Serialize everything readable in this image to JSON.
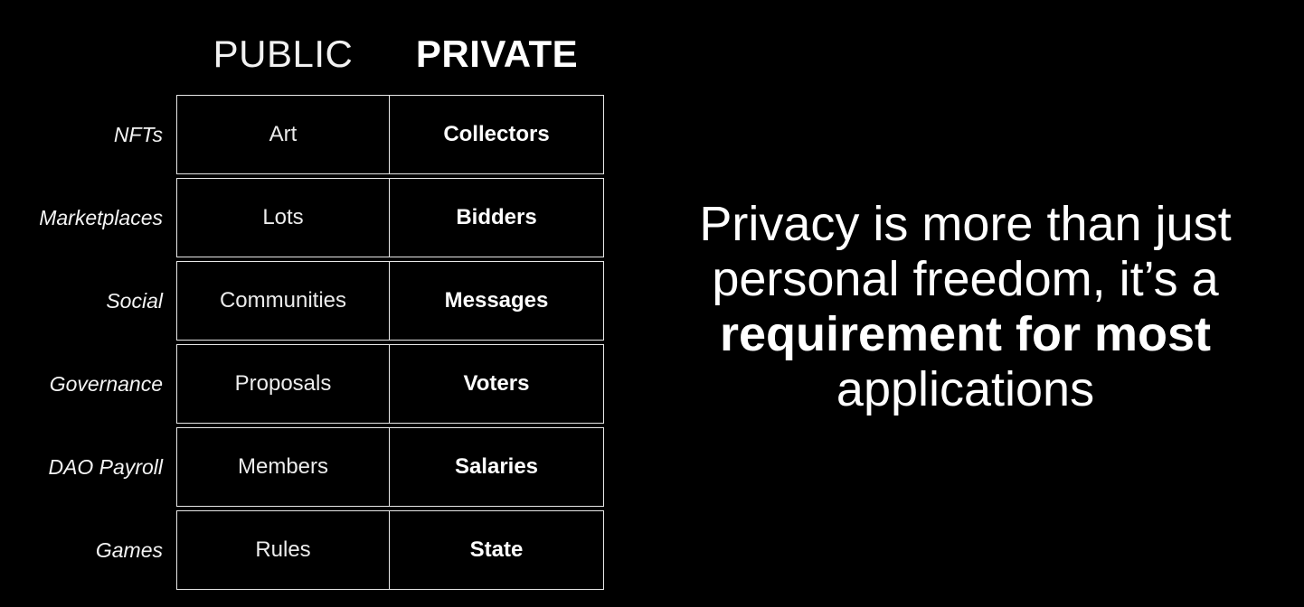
{
  "background_color": "#000000",
  "text_color": "#ffffff",
  "matrix": {
    "column_headers": {
      "public": "PUBLIC",
      "private": "PRIVATE"
    },
    "rows": [
      {
        "label": "NFTs",
        "public": "Art",
        "private": "Collectors"
      },
      {
        "label": "Marketplaces",
        "public": "Lots",
        "private": "Bidders"
      },
      {
        "label": "Social",
        "public": "Communities",
        "private": "Messages"
      },
      {
        "label": "Governance",
        "public": "Proposals",
        "private": "Voters"
      },
      {
        "label": "DAO Payroll",
        "public": "Members",
        "private": "Salaries"
      },
      {
        "label": "Games",
        "public": "Rules",
        "private": "State"
      }
    ]
  },
  "statement": {
    "part1": "Privacy is more than just personal freedom, it’s a ",
    "emphasis": "requirement for most",
    "part2": " applications",
    "full_text": "Privacy is more than just personal freedom, it’s a requirement for most applications"
  }
}
